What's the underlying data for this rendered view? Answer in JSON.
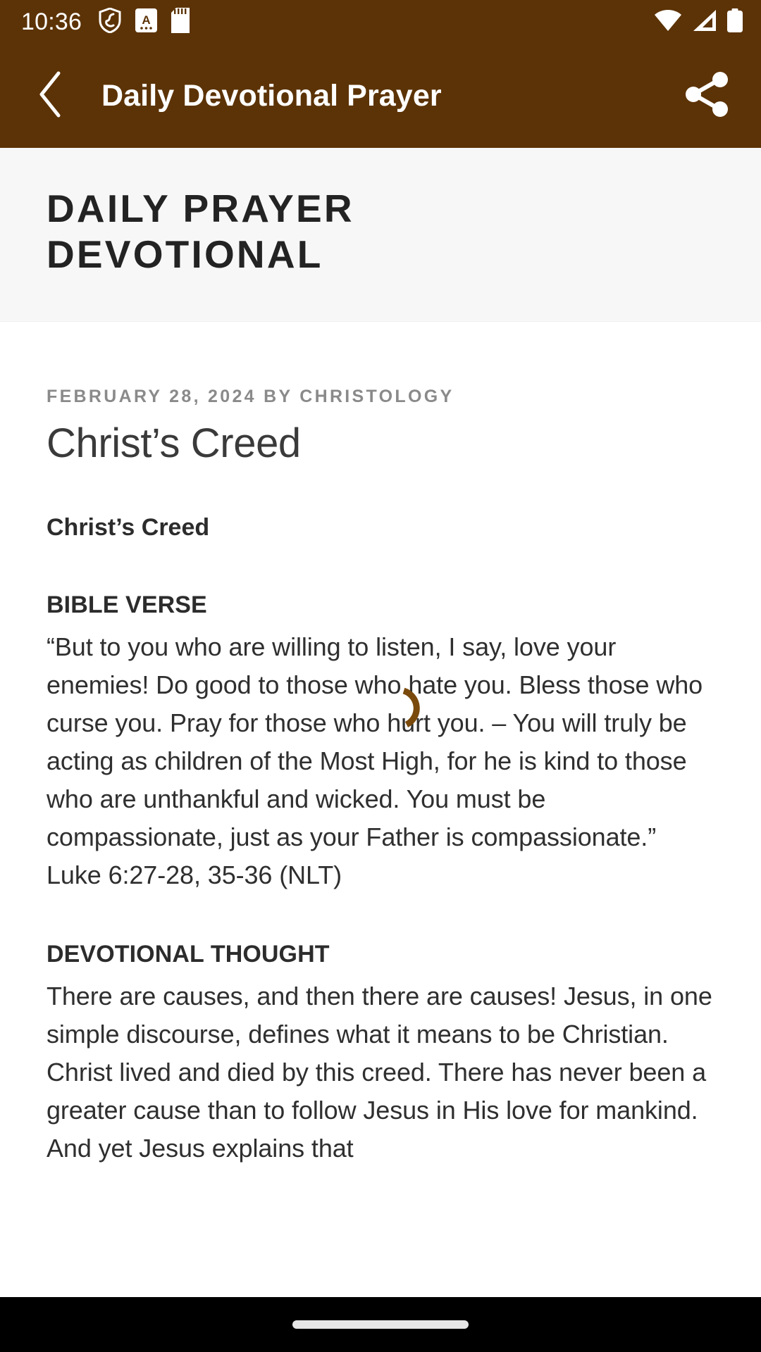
{
  "status_bar": {
    "time": "10:36",
    "left_icons": [
      "shield-icon",
      "app-badge-a-icon",
      "sd-card-icon"
    ],
    "right_icons": [
      "wifi-icon",
      "cellular-signal-icon",
      "battery-icon"
    ],
    "background_color": "#5C3306",
    "foreground_color": "#FFFFFF"
  },
  "app_bar": {
    "title": "Daily Devotional Prayer",
    "back_icon": "chevron-left-icon",
    "share_icon": "share-icon",
    "background_color": "#5C3306"
  },
  "site_header": {
    "line1": "DAILY PRAYER",
    "line2": "DEVOTIONAL",
    "background_color": "#F7F7F7"
  },
  "article": {
    "meta": "FEBRUARY 28, 2024 BY CHRISTOLOGY",
    "title": "Christ’s Creed",
    "subheading": "Christ’s Creed",
    "sections": [
      {
        "heading": "BIBLE VERSE",
        "body": "“But to you who are willing to listen, I say, love your enemies! Do good to those who hate you. Bless those who curse you. Pray for those who hurt you. – You will truly be acting as children of the Most High, for he is kind to those who are unthankful and wicked. You must be compassionate, just as your Father is compassionate.” Luke 6:27-28, 35-36 (NLT)"
      },
      {
        "heading": "DEVOTIONAL THOUGHT",
        "body": "There are causes, and then there are causes! Jesus, in one simple discourse, defines what it means to be Christian. Christ lived and died by this creed. There has never been a greater cause than to follow Jesus in His love for mankind. And yet Jesus explains that"
      }
    ]
  },
  "overlay": {
    "spinner_icon": "loading-spinner-icon",
    "spinner_color": "#7A4A0C"
  },
  "nav_bar": {
    "gesture_handle": "home-gesture-pill",
    "background_color": "#000000"
  }
}
